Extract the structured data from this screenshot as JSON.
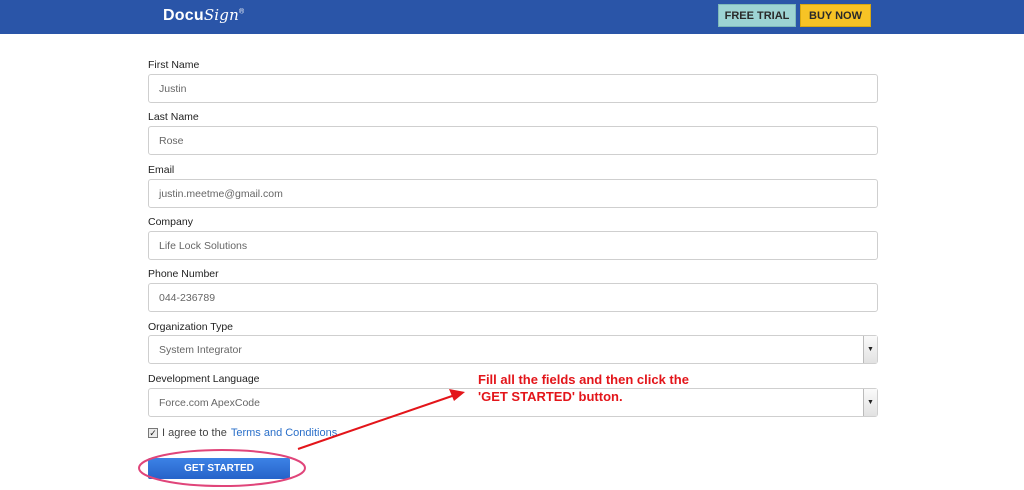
{
  "header": {
    "logo_text": "Docu",
    "logo_script": "Sign",
    "logo_tm": "®",
    "free_trial_label": "FREE TRIAL",
    "buy_now_label": "BUY NOW",
    "bar_color": "#2a55a8"
  },
  "form": {
    "first_name": {
      "label": "First Name",
      "value": "Justin"
    },
    "last_name": {
      "label": "Last Name",
      "value": "Rose"
    },
    "email": {
      "label": "Email",
      "value": "justin.meetme@gmail.com"
    },
    "company": {
      "label": "Company",
      "value": "Life Lock Solutions"
    },
    "phone": {
      "label": "Phone Number",
      "value": "044-236789"
    },
    "org_type": {
      "label": "Organization Type",
      "value": "System Integrator"
    },
    "dev_language": {
      "label": "Development Language",
      "value": "Force.com ApexCode"
    },
    "agree_text": "I agree to the",
    "terms_link": "Terms and Conditions",
    "agree_checked": true,
    "submit_label": "GET STARTED"
  },
  "annotation": {
    "line1": "Fill all the fields and then click the",
    "line2": "'GET STARTED' button.",
    "color": "#e3151a",
    "highlight_color": "#e0457a"
  }
}
